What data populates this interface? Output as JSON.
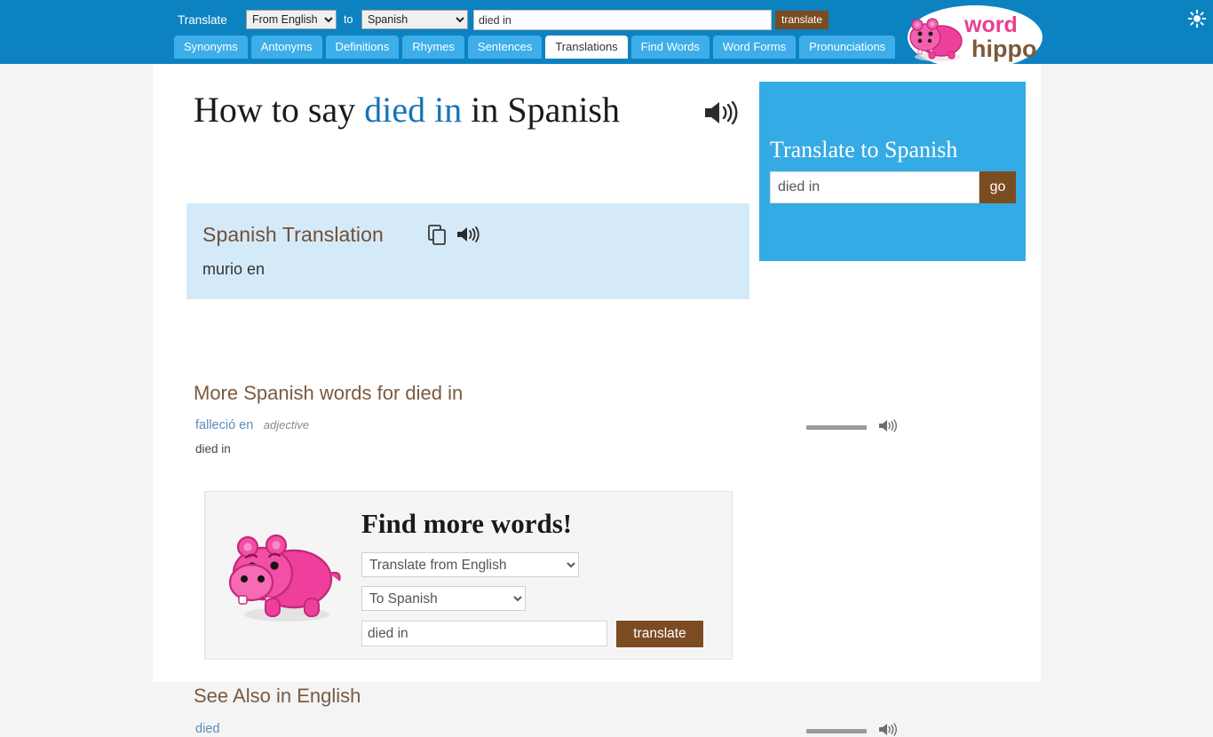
{
  "header": {
    "translate_label": "Translate",
    "from_select": {
      "value": "From English",
      "options": [
        "From English"
      ]
    },
    "to_label": "to",
    "to_select": {
      "value": "Spanish",
      "options": [
        "Spanish"
      ]
    },
    "search_value": "died in",
    "search_placeholder": "",
    "translate_button": "translate",
    "star_icon": "sun-icon",
    "bg_color": "#0d82c1"
  },
  "tabs": [
    {
      "label": "Synonyms",
      "active": false
    },
    {
      "label": "Antonyms",
      "active": false
    },
    {
      "label": "Definitions",
      "active": false
    },
    {
      "label": "Rhymes",
      "active": false
    },
    {
      "label": "Sentences",
      "active": false
    },
    {
      "label": "Translations",
      "active": true
    },
    {
      "label": "Find Words",
      "active": false
    },
    {
      "label": "Word Forms",
      "active": false
    },
    {
      "label": "Pronunciations",
      "active": false
    }
  ],
  "logo": {
    "word": "word",
    "hippo": "hippo",
    "word_color": "#ea3f90",
    "hippo_color": "#7b5a3a"
  },
  "main": {
    "title_prefix": "How to say",
    "title_highlight": "died in",
    "title_suffix": "in Spanish",
    "title_speaker_icon": "speaker-icon",
    "translation_box": {
      "heading": "Spanish Translation",
      "copy_icon": "copy-icon",
      "speaker_icon": "speaker-icon",
      "value": "murio en",
      "bg_color": "#d5eaf8"
    },
    "more_words_heading": "More Spanish words for died in",
    "more_words": [
      {
        "word": "falleció en",
        "pos": "adjective",
        "definition": "died in"
      }
    ],
    "see_also_heading": "See Also in English",
    "see_also": [
      {
        "word": "died"
      }
    ]
  },
  "find_panel": {
    "title": "Find more words!",
    "mascot": "hippo-mascot",
    "from_select": {
      "value": "Translate from English",
      "options": [
        "Translate from English"
      ]
    },
    "to_select": {
      "value": "To Spanish",
      "options": [
        "To Spanish"
      ]
    },
    "input_value": "died in",
    "button_label": "translate"
  },
  "sidebar": {
    "title": "Translate to Spanish",
    "input_value": "died in",
    "go_label": "go",
    "bg_color": "#35abe5"
  }
}
